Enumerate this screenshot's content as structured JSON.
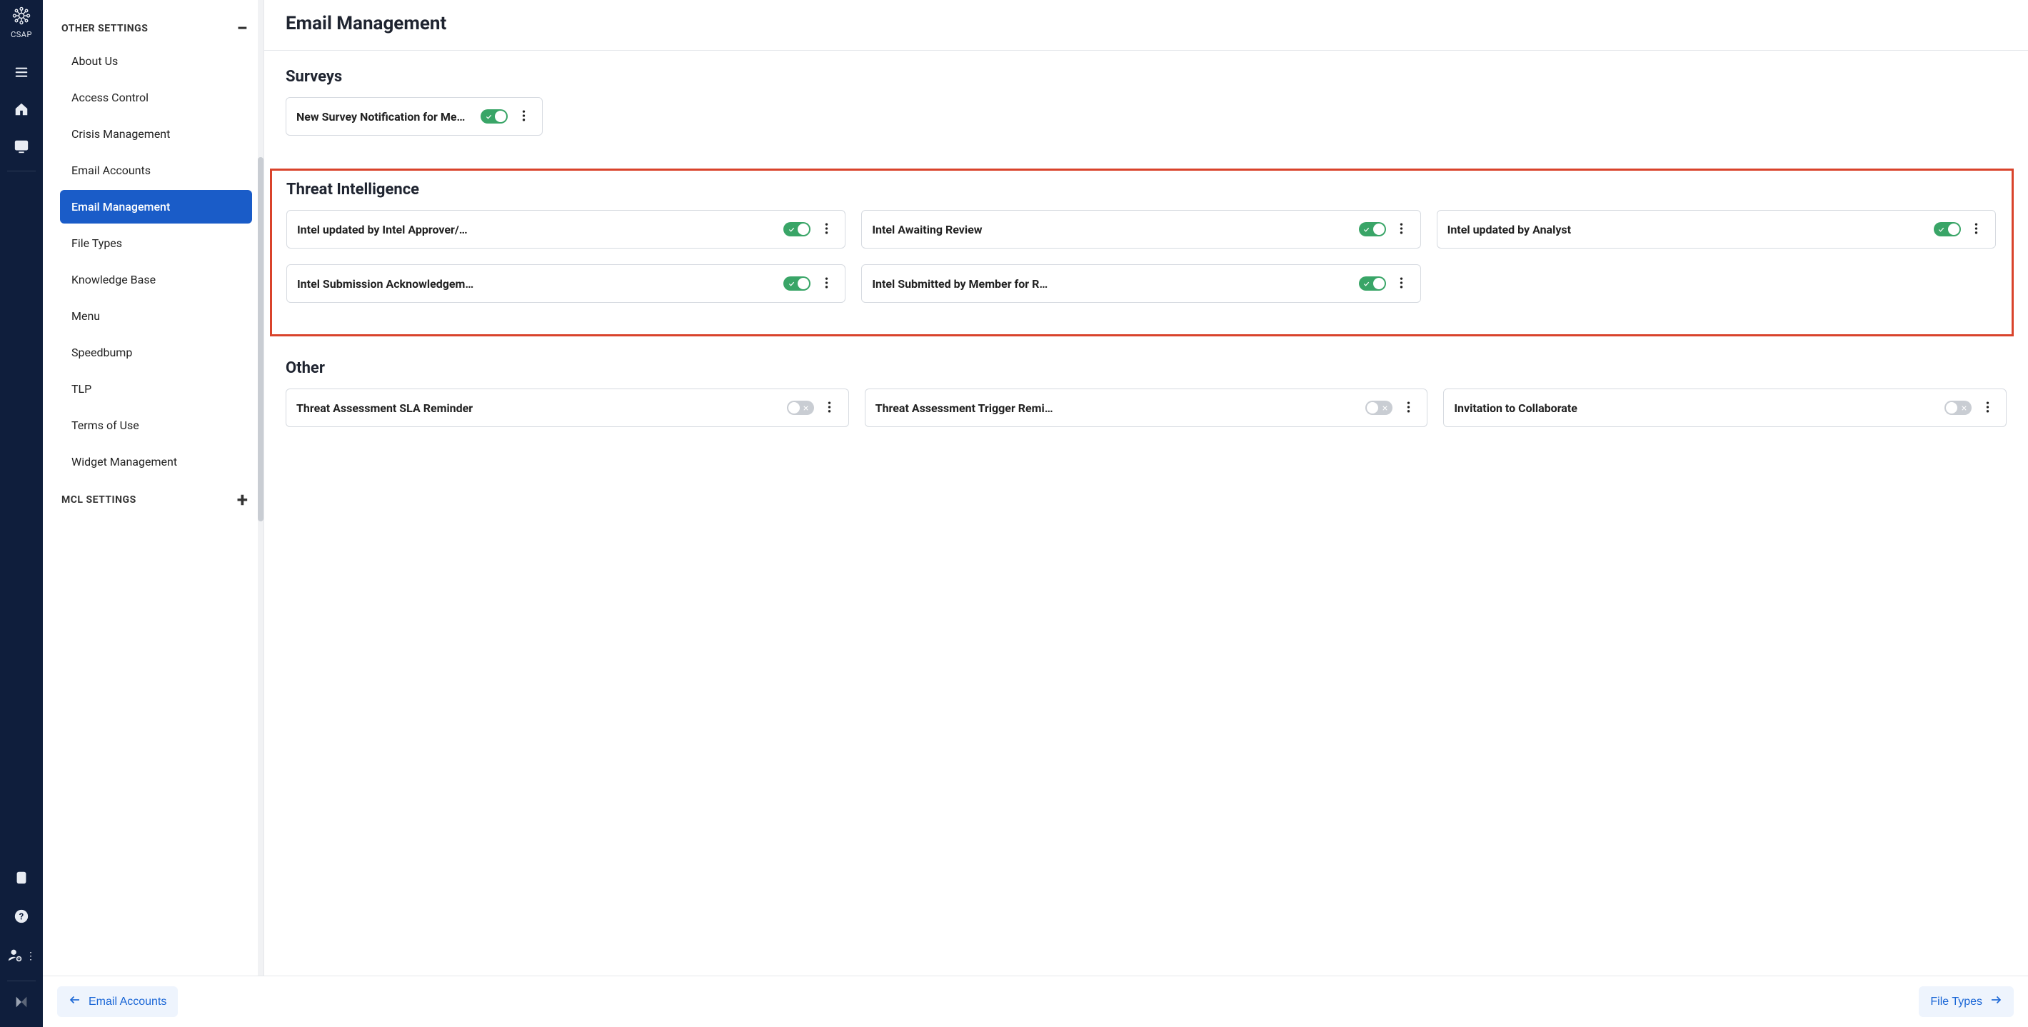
{
  "brand": {
    "name": "CSAP"
  },
  "rail": {
    "items_top": [
      "menu",
      "home",
      "monitor"
    ],
    "items_bottom": [
      "clipboard",
      "help",
      "user",
      "logo"
    ]
  },
  "sidebar": {
    "sections": [
      {
        "key": "other",
        "label": "OTHER SETTINGS",
        "expanded": true,
        "toggle_glyph": "−",
        "items": [
          {
            "label": "About Us",
            "active": false
          },
          {
            "label": "Access Control",
            "active": false
          },
          {
            "label": "Crisis Management",
            "active": false
          },
          {
            "label": "Email Accounts",
            "active": false
          },
          {
            "label": "Email Management",
            "active": true
          },
          {
            "label": "File Types",
            "active": false
          },
          {
            "label": "Knowledge Base",
            "active": false
          },
          {
            "label": "Menu",
            "active": false
          },
          {
            "label": "Speedbump",
            "active": false
          },
          {
            "label": "TLP",
            "active": false
          },
          {
            "label": "Terms of Use",
            "active": false
          },
          {
            "label": "Widget Management",
            "active": false
          }
        ]
      },
      {
        "key": "mcl",
        "label": "MCL SETTINGS",
        "expanded": false,
        "toggle_glyph": "+",
        "items": []
      }
    ]
  },
  "page": {
    "title": "Email Management",
    "sections": [
      {
        "key": "surveys",
        "title": "Surveys",
        "highlighted": false,
        "single_column": true,
        "cards": [
          {
            "label": "New Survey Notification for Me…",
            "on": true
          }
        ]
      },
      {
        "key": "threat_intel",
        "title": "Threat Intelligence",
        "highlighted": true,
        "single_column": false,
        "cards": [
          {
            "label": "Intel updated by Intel Approver/…",
            "on": true
          },
          {
            "label": "Intel Awaiting Review",
            "on": true
          },
          {
            "label": "Intel updated by Analyst",
            "on": true
          },
          {
            "label": "Intel Submission Acknowledgem…",
            "on": true
          },
          {
            "label": "Intel Submitted by Member for R…",
            "on": true
          }
        ]
      },
      {
        "key": "other",
        "title": "Other",
        "highlighted": false,
        "single_column": false,
        "cards": [
          {
            "label": "Threat Assessment SLA Reminder",
            "on": false
          },
          {
            "label": "Threat Assessment Trigger Remi…",
            "on": false
          },
          {
            "label": "Invitation to Collaborate",
            "on": false
          }
        ]
      }
    ]
  },
  "bottom_nav": {
    "prev": {
      "label": "Email Accounts"
    },
    "next": {
      "label": "File Types"
    }
  }
}
